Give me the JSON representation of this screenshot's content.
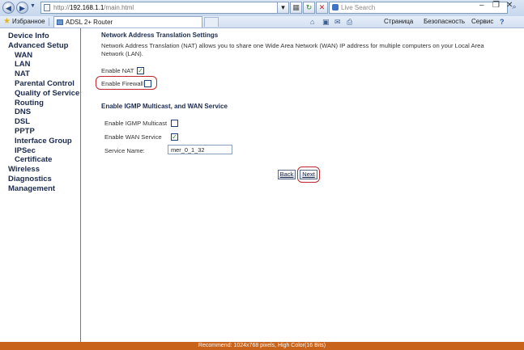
{
  "browser": {
    "url_prefix": "http://",
    "url_host": "192.168.1.1",
    "url_path": "/main.html",
    "search_placeholder": "Live Search",
    "favorites_label": "Избранное",
    "tab_title": "ADSL 2+ Router",
    "commands": {
      "page": "Страница",
      "security": "Безопасность",
      "tools": "Сервис"
    }
  },
  "sidebar": {
    "items": [
      {
        "label": "Device Info",
        "level": 1
      },
      {
        "label": "Advanced Setup",
        "level": 1
      },
      {
        "label": "WAN",
        "level": 2
      },
      {
        "label": "LAN",
        "level": 2
      },
      {
        "label": "NAT",
        "level": 2
      },
      {
        "label": "Parental Control",
        "level": 2
      },
      {
        "label": "Quality of Service",
        "level": 2
      },
      {
        "label": "Routing",
        "level": 2
      },
      {
        "label": "DNS",
        "level": 2
      },
      {
        "label": "DSL",
        "level": 2
      },
      {
        "label": "PPTP",
        "level": 2
      },
      {
        "label": "Interface Group",
        "level": 2
      },
      {
        "label": "IPSec",
        "level": 2
      },
      {
        "label": "Certificate",
        "level": 2
      },
      {
        "label": "Wireless",
        "level": 1
      },
      {
        "label": "Diagnostics",
        "level": 1
      },
      {
        "label": "Management",
        "level": 1
      }
    ]
  },
  "main": {
    "nat_title": "Network Address Translation Settings",
    "nat_desc": "Network Address Translation (NAT) allows you to share one Wide Area Network (WAN) IP address for multiple computers on your Local Area Network (LAN).",
    "enable_nat_label": "Enable NAT",
    "enable_nat_checked": true,
    "enable_firewall_label": "Enable Firewall",
    "enable_firewall_checked": false,
    "igmp_title": "Enable IGMP Multicast, and WAN Service",
    "igmp_label": "Enable IGMP Multicast",
    "igmp_checked": false,
    "wan_service_label": "Enable WAN Service",
    "wan_service_checked": true,
    "service_name_label": "Service Name:",
    "service_name_value": "mer_0_1_32",
    "back_label": "Back",
    "next_label": "Next"
  },
  "statusbar": {
    "text": "Recommend: 1024x768 pixels, High Color(16 Bits)"
  },
  "colors": {
    "highlight": "#c0262d",
    "statusbar": "#c8631c",
    "nav_text": "#1b2a4e"
  }
}
